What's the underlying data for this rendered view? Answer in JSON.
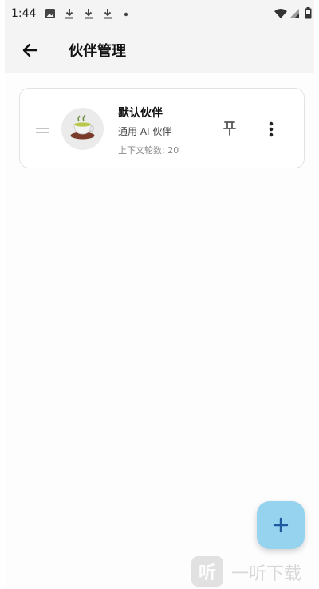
{
  "status_bar": {
    "time": "1:44",
    "icons": [
      "image-icon",
      "download-icon",
      "download-icon",
      "download-icon",
      "dot-icon",
      "wifi-icon",
      "signal-icon",
      "battery-icon"
    ]
  },
  "app_bar": {
    "title": "伙伴管理",
    "back_icon": "arrow-left-icon"
  },
  "partners": [
    {
      "name": "默认伙伴",
      "description": "通用 AI 伙伴",
      "context_rounds": "上下文轮数: 20",
      "avatar_icon": "tea-cup-icon",
      "actions": [
        "pin-icon",
        "more-vert-icon"
      ]
    }
  ],
  "fab": {
    "icon": "plus-icon",
    "color": "#96d3ef"
  },
  "watermark": {
    "logo_text": "听",
    "text": "一听下载"
  },
  "colors": {
    "bar_background": "#f4f4f4",
    "accent": "#1e5aa0",
    "fab": "#96d3ef"
  }
}
